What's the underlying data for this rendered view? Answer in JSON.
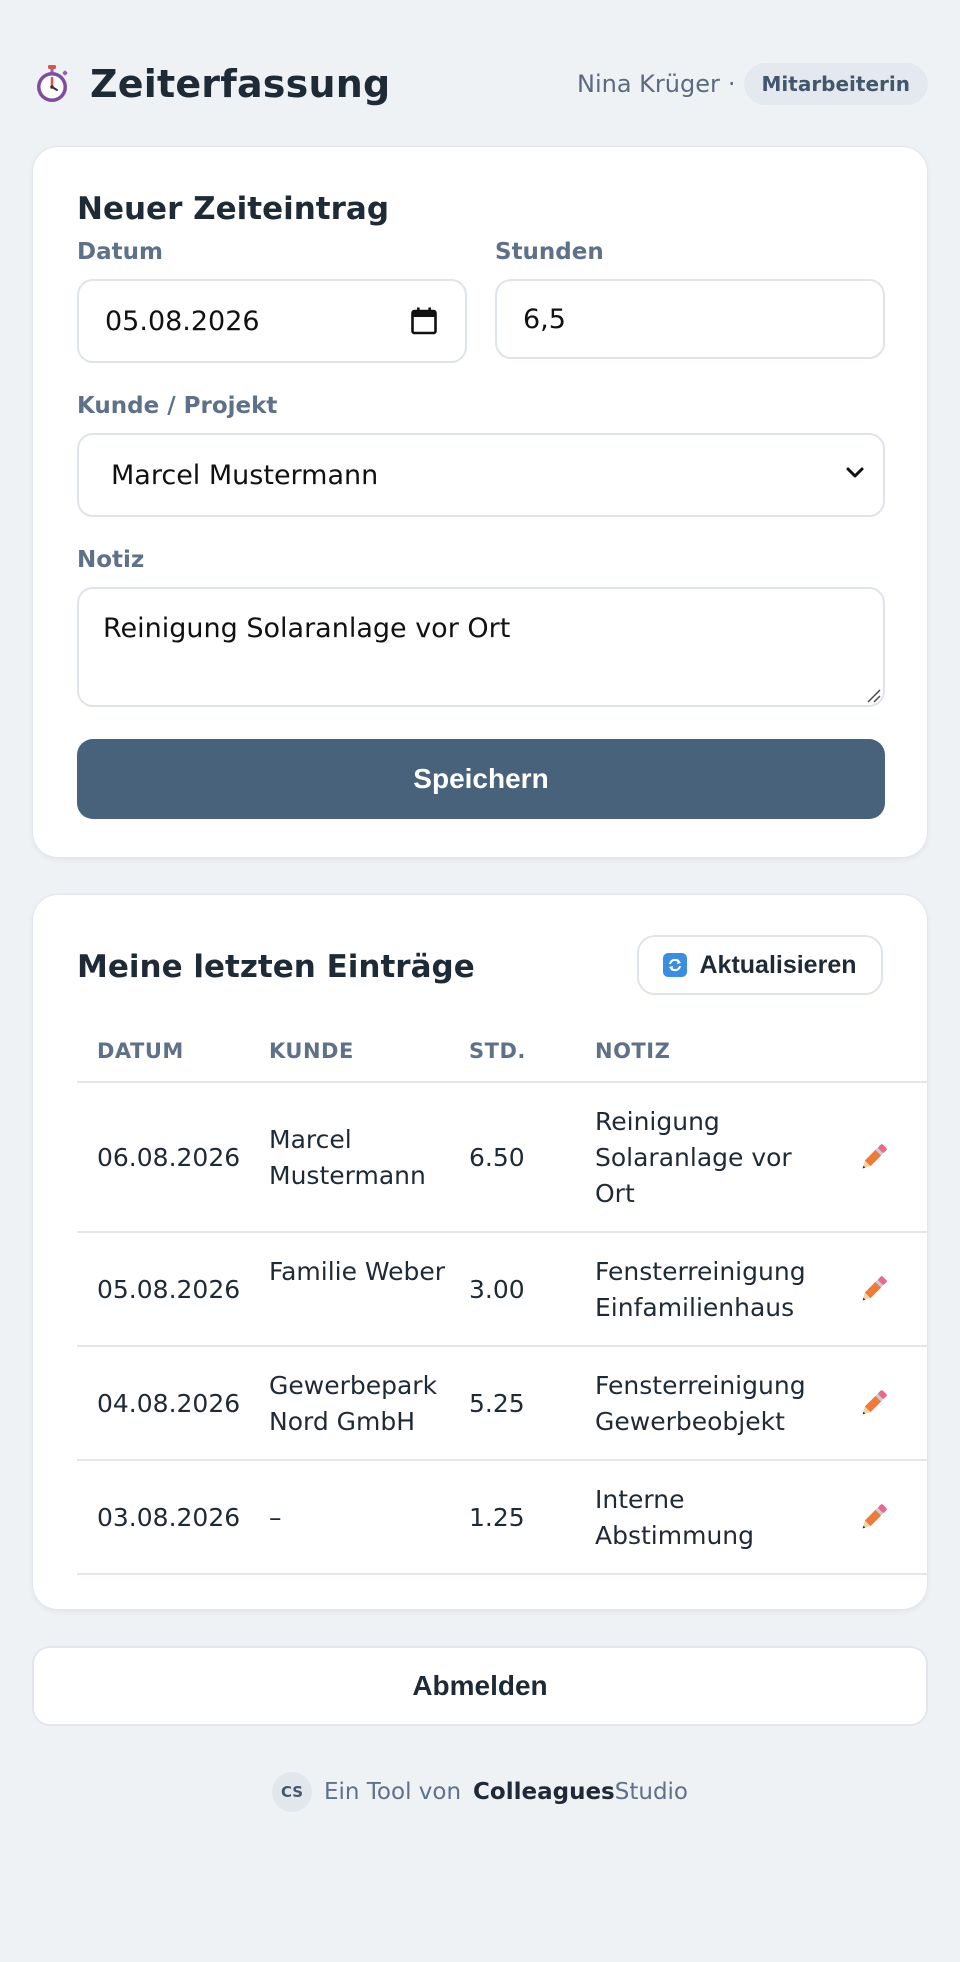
{
  "app": {
    "title": "Zeiterfassung",
    "icon": "stopwatch-icon"
  },
  "user": {
    "name": "Nina Krüger",
    "separator": "·",
    "role": "Mitarbeiterin"
  },
  "form": {
    "title": "Neuer Zeiteintrag",
    "date_label": "Datum",
    "date_value": "05.08.2026",
    "hours_label": "Stunden",
    "hours_value": "6,5",
    "customer_label": "Kunde / Projekt",
    "customer_value": "Marcel Mustermann",
    "note_label": "Notiz",
    "note_value": "Reinigung Solaranlage vor Ort",
    "save_label": "Speichern"
  },
  "entries": {
    "title": "Meine letzten Einträge",
    "refresh_label": "Aktualisieren",
    "columns": {
      "date": "DATUM",
      "customer": "KUNDE",
      "hours": "STD.",
      "note": "NOTIZ"
    },
    "rows": [
      {
        "date": "06.08.2026",
        "customer": "Marcel Mustermann",
        "hours": "6.50",
        "note": "Reinigung Solaranlage vor Ort"
      },
      {
        "date": "05.08.2026",
        "customer": "Familie Weber",
        "hours": "3.00",
        "note": "Fensterreinigung Einfamilienhaus"
      },
      {
        "date": "04.08.2026",
        "customer": "Gewerbepark Nord GmbH",
        "hours": "5.25",
        "note": "Fensterreinigung Gewerbeobjekt"
      },
      {
        "date": "03.08.2026",
        "customer": "–",
        "hours": "1.25",
        "note": "Interne Abstimmung"
      }
    ]
  },
  "logout_label": "Abmelden",
  "footer": {
    "badge": "CS",
    "prefix": "Ein Tool von",
    "brand_bold": "Colleagues",
    "brand_rest": "Studio"
  },
  "colors": {
    "primary_button": "#48627b",
    "background": "#eff2f5",
    "edit_icon": "#f07a3a",
    "delete_icon": "#a9abb6"
  }
}
